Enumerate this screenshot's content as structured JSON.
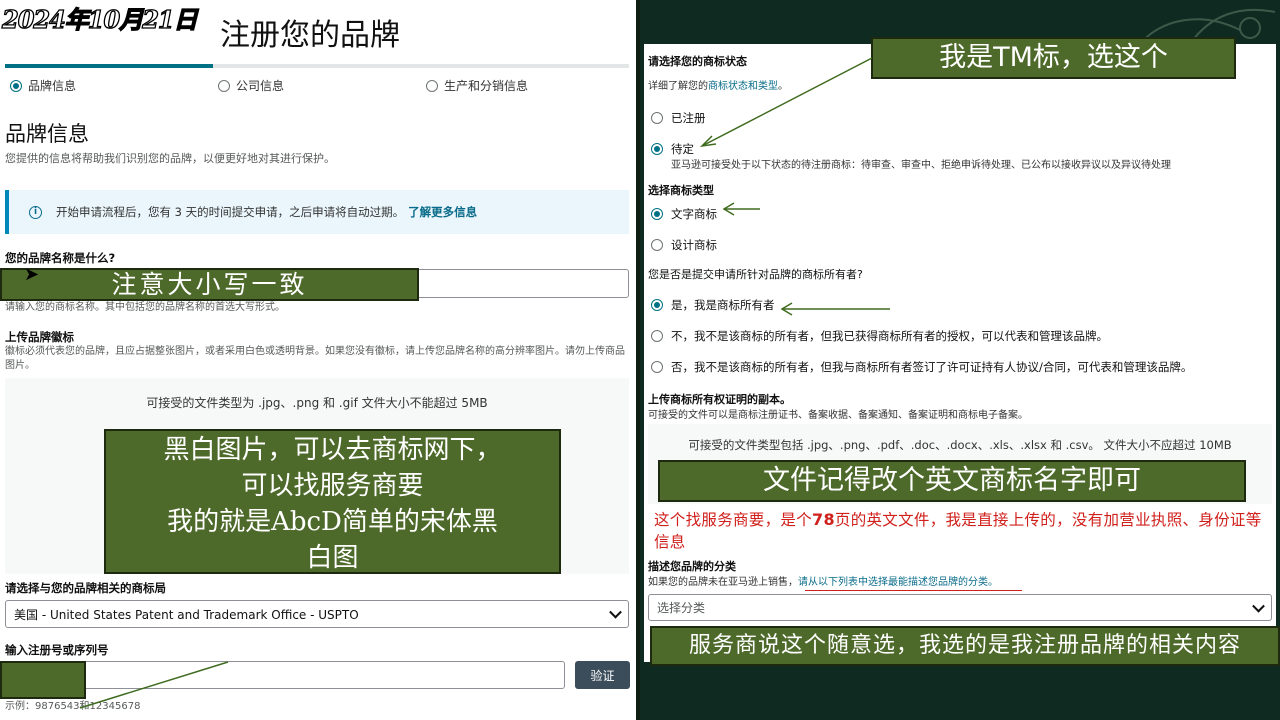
{
  "overlay_date": "2024年10月21日",
  "left": {
    "title": "注册您的品牌",
    "steps": [
      "品牌信息",
      "公司信息",
      "生产和分销信息"
    ],
    "section_title": "品牌信息",
    "section_desc": "您提供的信息将帮助我们识别您的品牌，以便更好地对其进行保护。",
    "info_box": {
      "text": "开始申请流程后，您有 3 天的时间提交申请，之后申请将自动过期。",
      "link": "了解更多信息"
    },
    "brand_name": {
      "label": "您的品牌名称是什么?",
      "help": "请输入您的商标名称。其中包括您的品牌名称的首选大写形式。"
    },
    "logo": {
      "label": "上传品牌徽标",
      "help": "徽标必须代表您的品牌，且应占据整张图片，或者采用白色或透明背景。如果您没有徽标，请上传您品牌名称的高分辨率图片。请勿上传商品图片。",
      "upload_text": "可接受的文件类型为 .jpg、.png 和 .gif    文件大小不能超过 5MB"
    },
    "office": {
      "label": "请选择与您的品牌相关的商标局",
      "selected": "美国 - United States Patent and Trademark Office - USPTO"
    },
    "reg_number": {
      "label": "输入注册号或序列号",
      "button": "验证",
      "example": "示例：9876543和12345678"
    },
    "annotations": {
      "case_note": "注意大小写一致",
      "logo_note": [
        "黑白图片，可以去商标网下，",
        "可以找服务商要",
        "我的就是AbcD简单的宋体黑",
        "白图"
      ]
    }
  },
  "right": {
    "status": {
      "title": "请选择您的商标状态",
      "desc_prefix": "详细了解您的",
      "desc_link": "商标状态和类型",
      "desc_suffix": "。",
      "options": [
        "已注册",
        "待定"
      ],
      "selected": 1,
      "pending_note": "亚马逊可接受处于以下状态的待注册商标：待审查、审查中、拒绝申诉待处理、已公布以接收异议以及异议待处理"
    },
    "type": {
      "title": "选择商标类型",
      "options": [
        "文字商标",
        "设计商标"
      ],
      "selected": 0
    },
    "owner": {
      "question": "您是否是提交申请所针对品牌的商标所有者?",
      "options": [
        "是，我是商标所有者",
        "不，我不是该商标的所有者，但我已获得商标所有者的授权，可以代表和管理该品牌。",
        "否，我不是该商标的所有者，但我与商标所有者签订了许可证持有人协议/合同，可代表和管理该品牌。"
      ],
      "selected": 0
    },
    "proof": {
      "title": "上传商标所有权证明的副本。",
      "desc": "可接受的文件可以是商标注册证书、备案收据、备案通知、备案证明和商标电子备案。",
      "upload_text": "可接受的文件类型包括 .jpg、.png、.pdf、.doc、.docx、.xls、.xlsx 和 .csv。     文件大小不应超过 10MB"
    },
    "category": {
      "title": "描述您品牌的分类",
      "desc_prefix": "如果您的品牌未在亚马逊上销售，",
      "desc_link": "请从以下列表中选择最能描述您品牌的分类。",
      "placeholder": "选择分类"
    },
    "annotations": {
      "tm_note": "我是TM标，选这个",
      "file_note": "文件记得改个英文商标名字即可",
      "red_note": {
        "before": "这个找服务商要，是个",
        "number": "78",
        "after": "页的英文文件，我是直接上传的，没有加营业执照、身份证等信息"
      },
      "category_note": "服务商说这个随意选，我选的是我注册品牌的相关内容"
    }
  },
  "colors": {
    "accent": "#007185",
    "annotation_green": "#4e6a2b",
    "red_note": "#d0201b",
    "right_bg": "#0f2a20"
  }
}
